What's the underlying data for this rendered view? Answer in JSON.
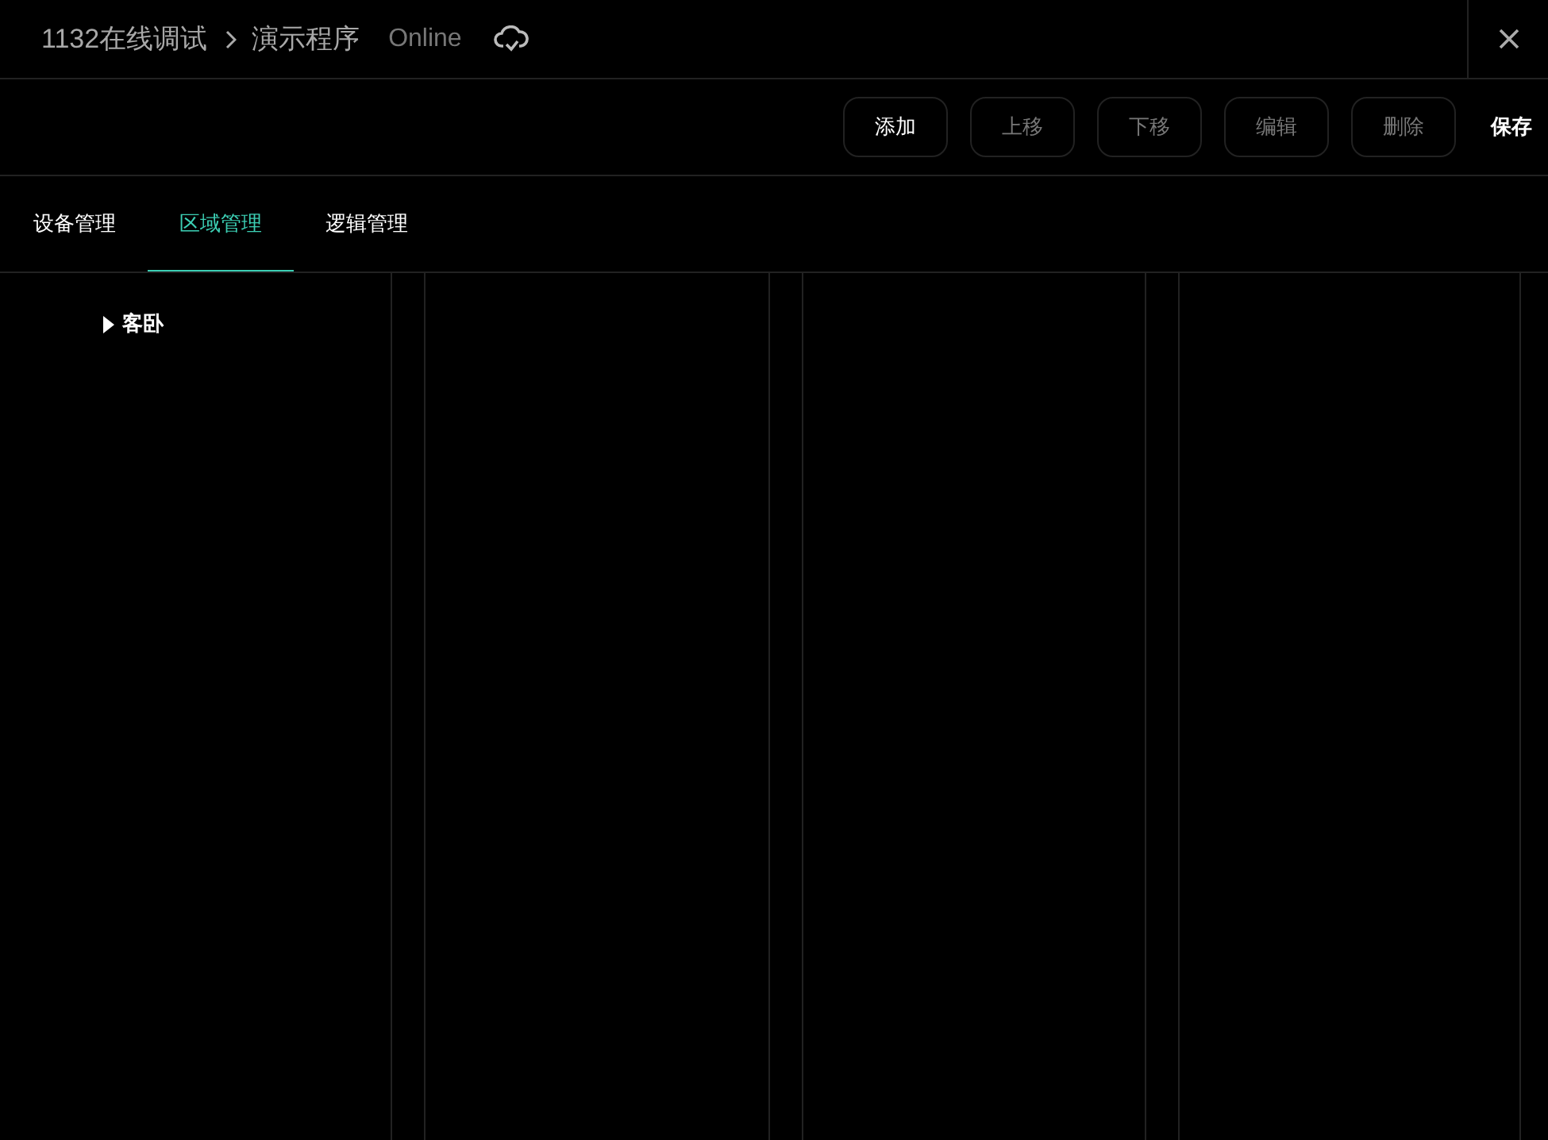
{
  "header": {
    "breadcrumb": [
      "1132在线调试",
      "演示程序"
    ],
    "status": "Online"
  },
  "toolbar": {
    "buttons": [
      {
        "label": "添加",
        "disabled": false
      },
      {
        "label": "上移",
        "disabled": true
      },
      {
        "label": "下移",
        "disabled": true
      },
      {
        "label": "编辑",
        "disabled": true
      },
      {
        "label": "删除",
        "disabled": true
      }
    ],
    "save": "保存"
  },
  "tabs": [
    {
      "label": "设备管理",
      "selected": false
    },
    {
      "label": "区域管理",
      "selected": true
    },
    {
      "label": "逻辑管理",
      "selected": false
    }
  ],
  "tree": [
    {
      "label": "客卧",
      "expanded": false
    }
  ]
}
